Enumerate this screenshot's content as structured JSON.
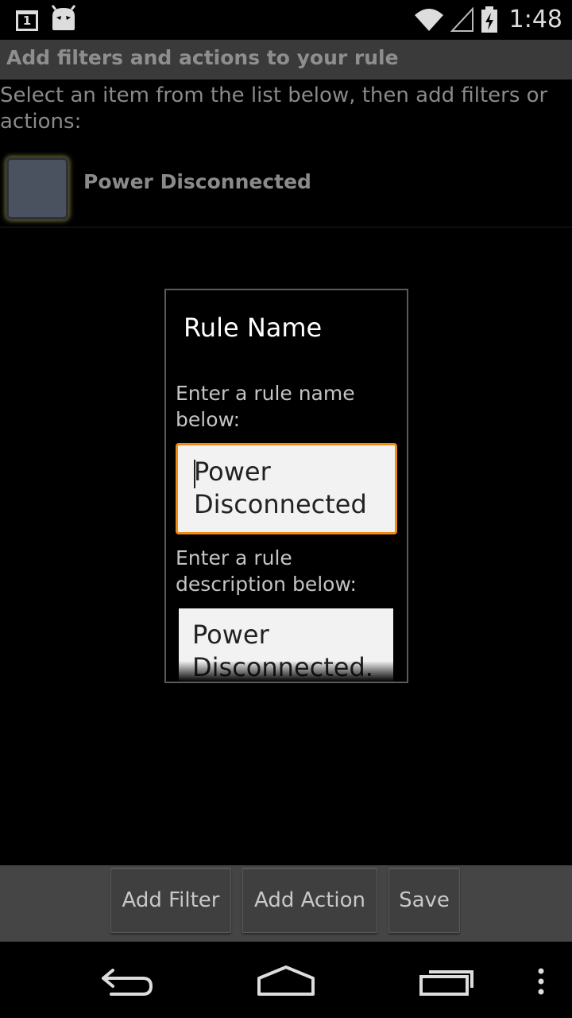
{
  "status_bar": {
    "time": "1:48",
    "icons": [
      "calendar-notification-icon",
      "android-notification-icon",
      "wifi-icon",
      "signal-icon",
      "battery-charging-icon"
    ],
    "calendar_day": "1"
  },
  "title_bar": {
    "title": "Add filters and actions to your rule"
  },
  "instruction": "Select an item from the list below, then add filters or actions:",
  "list": {
    "items": [
      {
        "label": "Power Disconnected",
        "checked": false
      }
    ]
  },
  "dialog": {
    "title": "Rule Name",
    "name_label": "Enter a rule name below:",
    "name_value": "Power Disconnected",
    "description_label": "Enter a rule description below:",
    "description_value": "Power Disconnected."
  },
  "action_bar": {
    "add_filter": "Add Filter",
    "add_action": "Add Action",
    "save": "Save"
  },
  "nav_bar": {
    "icons": [
      "back-icon",
      "home-icon",
      "recent-apps-icon",
      "overflow-menu-icon"
    ]
  },
  "colors": {
    "focus_border": "#f18a13",
    "title_bar_bg": "#3a3a3a",
    "action_bar_bg": "#454545"
  }
}
